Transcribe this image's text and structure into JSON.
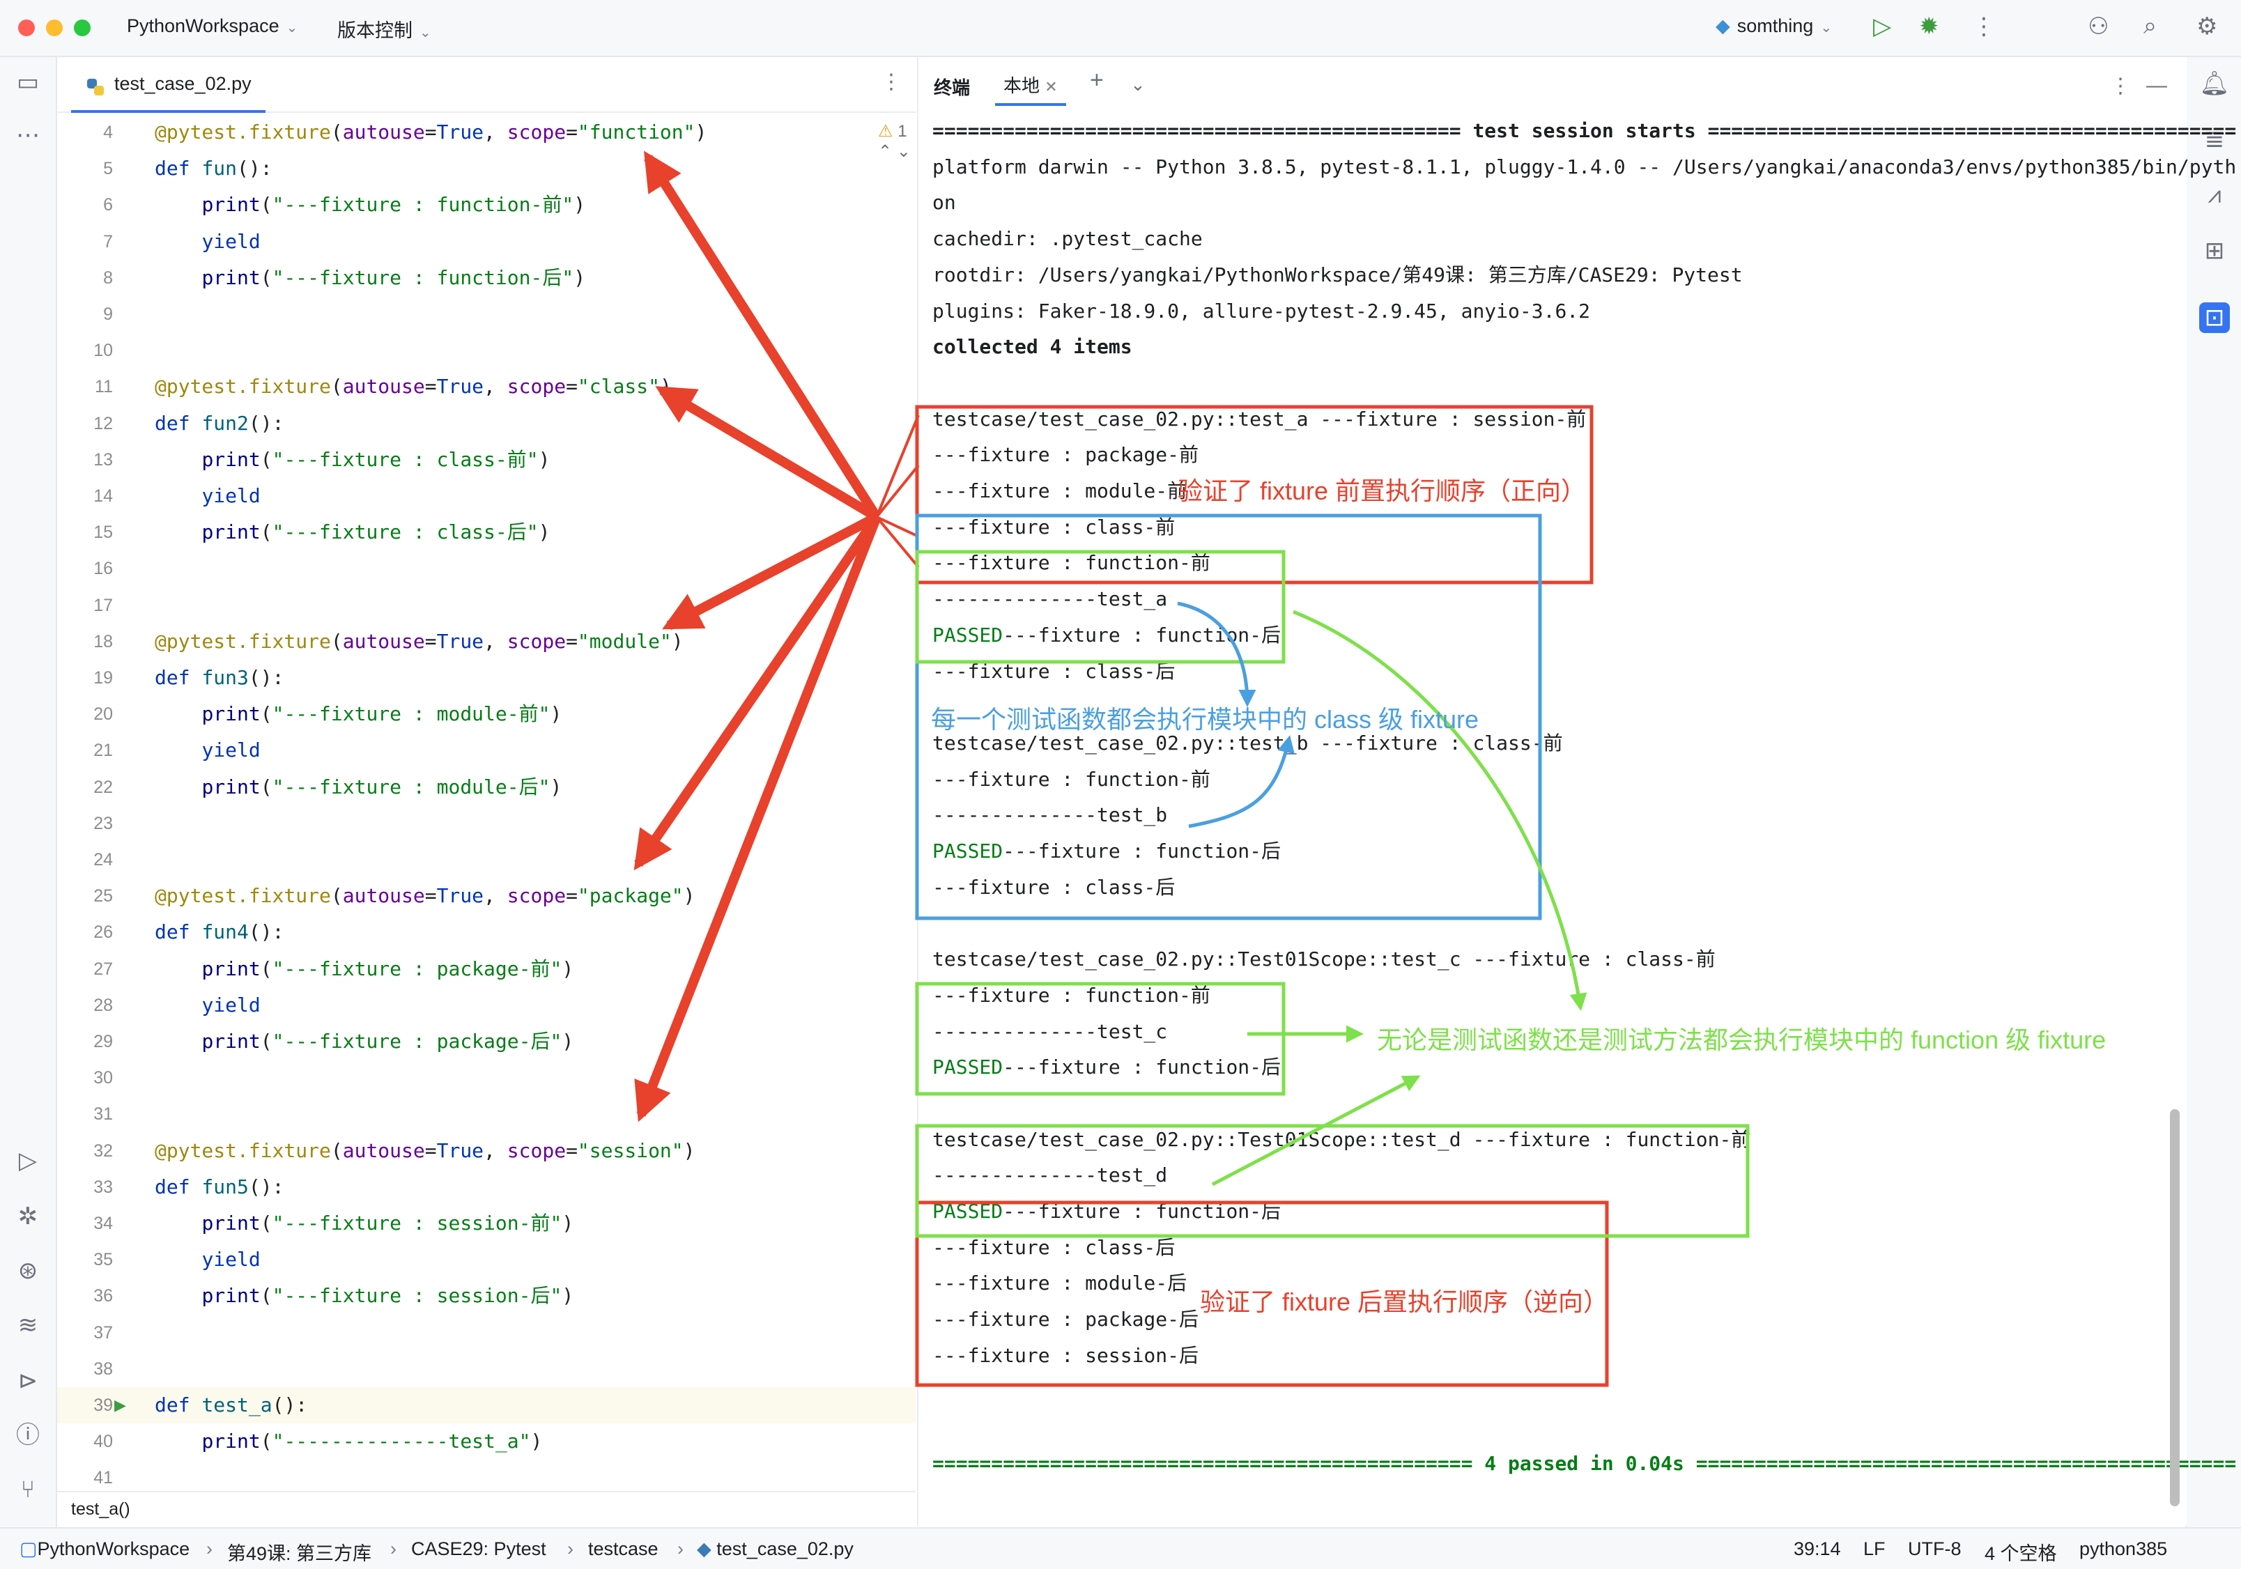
{
  "titlebar": {
    "project": "PythonWorkspace",
    "vcs": "版本控制",
    "run_config": "somthing"
  },
  "editor": {
    "tab_label": "test_case_02.py",
    "inspection_count": "1",
    "breadcrumb": "test_a()",
    "lines": [
      {
        "n": "4",
        "text": "@pytest.fixture(autouse=True, scope=\"function\")"
      },
      {
        "n": "5",
        "text": "def fun():"
      },
      {
        "n": "6",
        "text": "    print(\"---fixture : function-前\")"
      },
      {
        "n": "7",
        "text": "    yield"
      },
      {
        "n": "8",
        "text": "    print(\"---fixture : function-后\")"
      },
      {
        "n": "9",
        "text": ""
      },
      {
        "n": "10",
        "text": ""
      },
      {
        "n": "11",
        "text": "@pytest.fixture(autouse=True, scope=\"class\")"
      },
      {
        "n": "12",
        "text": "def fun2():"
      },
      {
        "n": "13",
        "text": "    print(\"---fixture : class-前\")"
      },
      {
        "n": "14",
        "text": "    yield"
      },
      {
        "n": "15",
        "text": "    print(\"---fixture : class-后\")"
      },
      {
        "n": "16",
        "text": ""
      },
      {
        "n": "17",
        "text": ""
      },
      {
        "n": "18",
        "text": "@pytest.fixture(autouse=True, scope=\"module\")"
      },
      {
        "n": "19",
        "text": "def fun3():"
      },
      {
        "n": "20",
        "text": "    print(\"---fixture : module-前\")"
      },
      {
        "n": "21",
        "text": "    yield"
      },
      {
        "n": "22",
        "text": "    print(\"---fixture : module-后\")"
      },
      {
        "n": "23",
        "text": ""
      },
      {
        "n": "24",
        "text": ""
      },
      {
        "n": "25",
        "text": "@pytest.fixture(autouse=True, scope=\"package\")"
      },
      {
        "n": "26",
        "text": "def fun4():"
      },
      {
        "n": "27",
        "text": "    print(\"---fixture : package-前\")"
      },
      {
        "n": "28",
        "text": "    yield"
      },
      {
        "n": "29",
        "text": "    print(\"---fixture : package-后\")"
      },
      {
        "n": "30",
        "text": ""
      },
      {
        "n": "31",
        "text": ""
      },
      {
        "n": "32",
        "text": "@pytest.fixture(autouse=True, scope=\"session\")"
      },
      {
        "n": "33",
        "text": "def fun5():"
      },
      {
        "n": "34",
        "text": "    print(\"---fixture : session-前\")"
      },
      {
        "n": "35",
        "text": "    yield"
      },
      {
        "n": "36",
        "text": "    print(\"---fixture : session-后\")"
      },
      {
        "n": "37",
        "text": ""
      },
      {
        "n": "38",
        "text": ""
      },
      {
        "n": "39",
        "text": "def test_a():"
      },
      {
        "n": "40",
        "text": "    print(\"--------------test_a\")"
      },
      {
        "n": "41",
        "text": ""
      }
    ]
  },
  "terminal": {
    "tab_terminal": "终端",
    "tab_local": "本地",
    "lines": [
      {
        "text": "============================================= test session starts =============================================",
        "cls": "b"
      },
      {
        "text": "platform darwin -- Python 3.8.5, pytest-8.1.1, pluggy-1.4.0 -- /Users/yangkai/anaconda3/envs/python385/bin/pyth"
      },
      {
        "text": "on"
      },
      {
        "text": "cachedir: .pytest_cache"
      },
      {
        "text": "rootdir: /Users/yangkai/PythonWorkspace/第49课: 第三方库/CASE29: Pytest"
      },
      {
        "text": "plugins: Faker-18.9.0, allure-pytest-2.9.45, anyio-3.6.2"
      },
      {
        "text": "collected 4 items",
        "cls": "b"
      },
      {
        "text": ""
      },
      {
        "text": "testcase/test_case_02.py::test_a ---fixture : session-前"
      },
      {
        "text": "---fixture : package-前"
      },
      {
        "text": "---fixture : module-前"
      },
      {
        "text": "---fixture : class-前"
      },
      {
        "text": "---fixture : function-前"
      },
      {
        "text": "--------------test_a"
      },
      {
        "text": "---fixture : function-后",
        "pass": "PASSED"
      },
      {
        "text": "---fixture : class-后"
      },
      {
        "text": ""
      },
      {
        "text": "testcase/test_case_02.py::test_b ---fixture : class-前"
      },
      {
        "text": "---fixture : function-前"
      },
      {
        "text": "--------------test_b"
      },
      {
        "text": "---fixture : function-后",
        "pass": "PASSED"
      },
      {
        "text": "---fixture : class-后"
      },
      {
        "text": ""
      },
      {
        "text": "testcase/test_case_02.py::Test01Scope::test_c ---fixture : class-前"
      },
      {
        "text": "---fixture : function-前"
      },
      {
        "text": "--------------test_c"
      },
      {
        "text": "---fixture : function-后",
        "pass": "PASSED"
      },
      {
        "text": ""
      },
      {
        "text": "testcase/test_case_02.py::Test01Scope::test_d ---fixture : function-前"
      },
      {
        "text": "--------------test_d"
      },
      {
        "text": "---fixture : function-后",
        "pass": "PASSED"
      },
      {
        "text": "---fixture : class-后"
      },
      {
        "text": "---fixture : module-后"
      },
      {
        "text": "---fixture : package-后"
      },
      {
        "text": "---fixture : session-后"
      },
      {
        "text": ""
      },
      {
        "text": ""
      },
      {
        "text": "============================================== 4 passed in 0.04s ==============================================",
        "cls": "b passed"
      }
    ]
  },
  "annotations": {
    "setup_order": "验证了 fixture 前置执行顺序（正向）",
    "class_level": "每一个测试函数都会执行模块中的 class 级 fixture",
    "function_level": "无论是测试函数还是测试方法都会执行模块中的 function 级 fixture",
    "teardown_order": "验证了 fixture 后置执行顺序（逆向）",
    "colors": {
      "red": "#e8412c",
      "blue": "#4a9fe0",
      "green": "#7ee04a"
    }
  },
  "statusbar": {
    "crumbs": [
      "PythonWorkspace",
      "第49课: 第三方库",
      "CASE29: Pytest",
      "testcase",
      "test_case_02.py"
    ],
    "position": "39:14",
    "line_sep": "LF",
    "encoding": "UTF-8",
    "indent": "4 个空格",
    "interpreter": "python385"
  }
}
